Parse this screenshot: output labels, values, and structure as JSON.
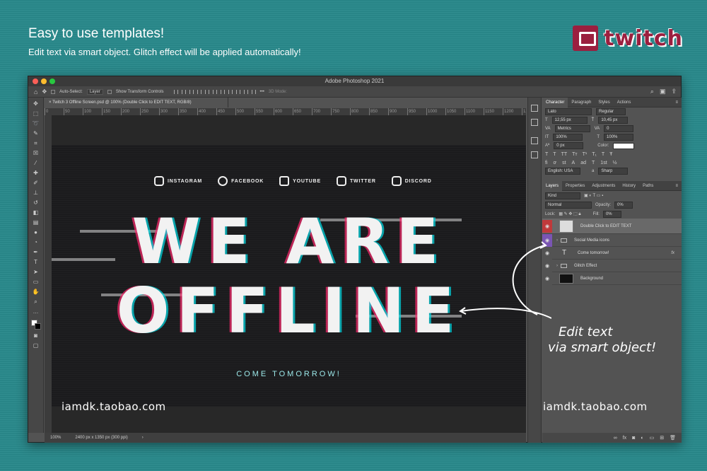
{
  "header": {
    "headline": "Easy to use templates!",
    "subline": "Edit text via smart object. Glitch effect will be applied automatically!",
    "brand": "twitch"
  },
  "window": {
    "app_title": "Adobe Photoshop 2021",
    "traffic_colors": [
      "#fc5f57",
      "#fdbc2e",
      "#28c840"
    ],
    "options": {
      "auto_select_label": "Auto-Select:",
      "auto_select_value": "Layer",
      "transform_label": "Show Transform Controls",
      "mode_3d": "3D Mode:"
    },
    "doc_tab": "Twitch 3 Offline Screen.psd @ 100% (Double Click to EDIT TEXT, RGB/8)",
    "ruler_ticks": [
      "0",
      "50",
      "100",
      "150",
      "200",
      "250",
      "300",
      "350",
      "400",
      "450",
      "500",
      "550",
      "600",
      "650",
      "700",
      "750",
      "800",
      "850",
      "900",
      "950",
      "1000",
      "1050",
      "1100",
      "1150",
      "1200",
      "1250",
      "1300",
      "1350",
      "1400",
      "1450",
      "1500",
      "1550",
      "1600",
      "1650",
      "1700",
      "1750",
      "1800",
      "1850",
      "1900",
      "1950",
      "2000",
      "2050",
      "2100",
      "2150",
      "2200",
      "2250",
      "2300",
      "2350",
      "2400"
    ],
    "status": {
      "zoom": "100%",
      "doc_size": "2400 px x 1350 px (300 ppi)",
      "arrow": "›"
    }
  },
  "artwork": {
    "social": [
      {
        "label": "INSTAGRAM",
        "icon": "instagram-icon"
      },
      {
        "label": "FACEBOOK",
        "icon": "facebook-icon"
      },
      {
        "label": "YOUTUBE",
        "icon": "youtube-icon"
      },
      {
        "label": "TWITTER",
        "icon": "twitter-icon"
      },
      {
        "label": "DISCORD",
        "icon": "discord-icon"
      }
    ],
    "line1": "WE ARE",
    "line2": "OFFLINE",
    "tagline": "COME TOMORROW!",
    "watermark": "iamdk.taobao.com"
  },
  "character_panel": {
    "tabs": [
      "Character",
      "Paragraph",
      "Styles",
      "Actions"
    ],
    "font_family": "Lato",
    "font_style": "Regular",
    "font_size": "12,55 px",
    "leading": "10,45 px",
    "kerning": "Metrics",
    "tracking": "0",
    "vertical_scale": "100%",
    "horizontal_scale": "100%",
    "baseline": "0 px",
    "color_label": "Color:",
    "language": "English: USA",
    "aa_label": "a",
    "antialias": "Sharp"
  },
  "layers_panel": {
    "tabs": [
      "Layers",
      "Properties",
      "Adjustments",
      "History",
      "Paths"
    ],
    "kind": "Kind",
    "blend_mode": "Normal",
    "opacity_label": "Opacity:",
    "opacity": "0%",
    "lock_label": "Lock:",
    "fill_label": "Fill:",
    "fill": "0%",
    "layers": [
      {
        "name": "Double Click to EDIT TEXT",
        "type": "smart",
        "selected": true,
        "eye_color": "#c0393b"
      },
      {
        "name": "Social Media icons",
        "type": "folder",
        "selected": false,
        "eye_color": "#7a55b3"
      },
      {
        "name": "Come tomorrow!",
        "type": "text",
        "selected": false,
        "eye_color": "#535353",
        "fx": "fx"
      },
      {
        "name": "Glitch Effect",
        "type": "folder",
        "selected": false,
        "eye_color": "#535353"
      },
      {
        "name": "Background",
        "type": "image",
        "selected": false,
        "eye_color": "#535353"
      }
    ]
  },
  "callouts": {
    "edit_text_line1": "Edit text",
    "edit_text_line2": "via smart object!",
    "watermark_right": "iamdk.taobao.com"
  }
}
